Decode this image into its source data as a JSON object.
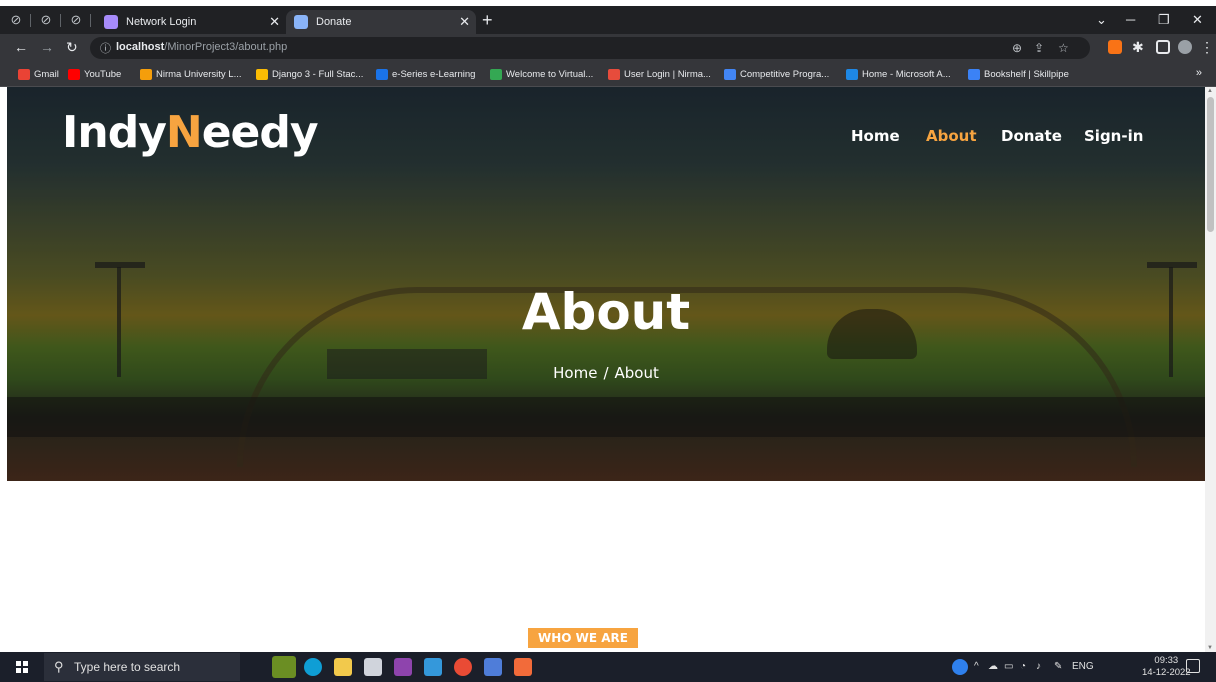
{
  "browser": {
    "tabs": [
      {
        "label": "Network Login",
        "favicon_color": "#a78bfa",
        "active": false
      },
      {
        "label": "Donate",
        "favicon_color": "#8ab4f8",
        "active": true
      }
    ],
    "address": {
      "host": "localhost",
      "path": "/MinorProject3/about.php"
    },
    "bookmarks": [
      {
        "label": "Gmail",
        "color": "#ea4335"
      },
      {
        "label": "YouTube",
        "color": "#ff0000"
      },
      {
        "label": "Nirma University L...",
        "color": "#f59e0b"
      },
      {
        "label": "Django 3 - Full Stac...",
        "color": "#fbbc04"
      },
      {
        "label": "e-Series e-Learning",
        "color": "#1a73e8"
      },
      {
        "label": "Welcome to Virtual...",
        "color": "#34a853"
      },
      {
        "label": "User Login | Nirma...",
        "color": "#e74c3c"
      },
      {
        "label": "Competitive Progra...",
        "color": "#4285f4"
      },
      {
        "label": "Home - Microsoft A...",
        "color": "#1e88e5"
      },
      {
        "label": "Bookshelf | Skillpipe",
        "color": "#3b82f6"
      }
    ]
  },
  "site": {
    "logo_part1": "Indy",
    "logo_accent": "N",
    "logo_part2": "eedy",
    "accent_color": "#f7a440",
    "nav": [
      {
        "label": "Home",
        "active": false
      },
      {
        "label": "About",
        "active": true
      },
      {
        "label": "Donate",
        "active": false
      },
      {
        "label": "Sign-in",
        "active": false
      }
    ],
    "hero_title": "About",
    "breadcrumb": [
      "Home",
      "/",
      "About"
    ],
    "section_badge": "WHO WE ARE"
  },
  "taskbar": {
    "search_placeholder": "Type here to search",
    "language": "ENG",
    "time": "09:33",
    "date": "14-12-2022"
  }
}
